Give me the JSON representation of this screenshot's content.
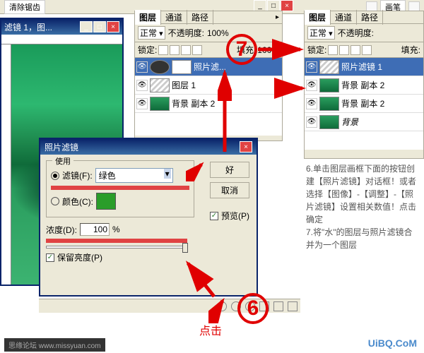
{
  "toolbar": {
    "clear": "清除锯齿",
    "brush": "画笔"
  },
  "canvas_win": {
    "title": "滤镜 1，图..."
  },
  "panel": {
    "tabs": [
      "图层",
      "通道",
      "路径"
    ],
    "blend": "正常",
    "opacity_label": "不透明度:",
    "opacity_val": "100%",
    "lock_label": "锁定:",
    "fill_label": "填充:",
    "fill_val": "100%"
  },
  "layers1": [
    {
      "name": "照片滤..."
    },
    {
      "name": "图层 1"
    },
    {
      "name": "背景 副本 2"
    }
  ],
  "layers2": [
    {
      "name": "照片滤镜 1"
    },
    {
      "name": "背景 副本 2"
    },
    {
      "name": "背景 副本 2"
    },
    {
      "italic": true,
      "name": "背景"
    }
  ],
  "dialog": {
    "title": "照片滤镜",
    "group": "使用",
    "filter_label": "滤镜(F):",
    "filter_val": "绿色",
    "color_label": "颜色(C):",
    "ok": "好",
    "cancel": "取消",
    "preview": "预览(P)",
    "density_label": "浓度(D):",
    "density_val": "100",
    "pct": "%",
    "keep_lum": "保留亮度(P)"
  },
  "anno": {
    "num7": "7",
    "num6": "6",
    "click": "点击",
    "instr": "6.单击图层画框下面的按钮创建【照片滤镜】对话框！或者选择【图像】-【调整】-【照片滤镜】设置相关数值！点击确定\n7.将\"水\"的图层与照片滤镜合并为一个图层"
  },
  "watermark": "UiBQ.CoM",
  "credit": "思缘论坛  www.missyuan.com"
}
